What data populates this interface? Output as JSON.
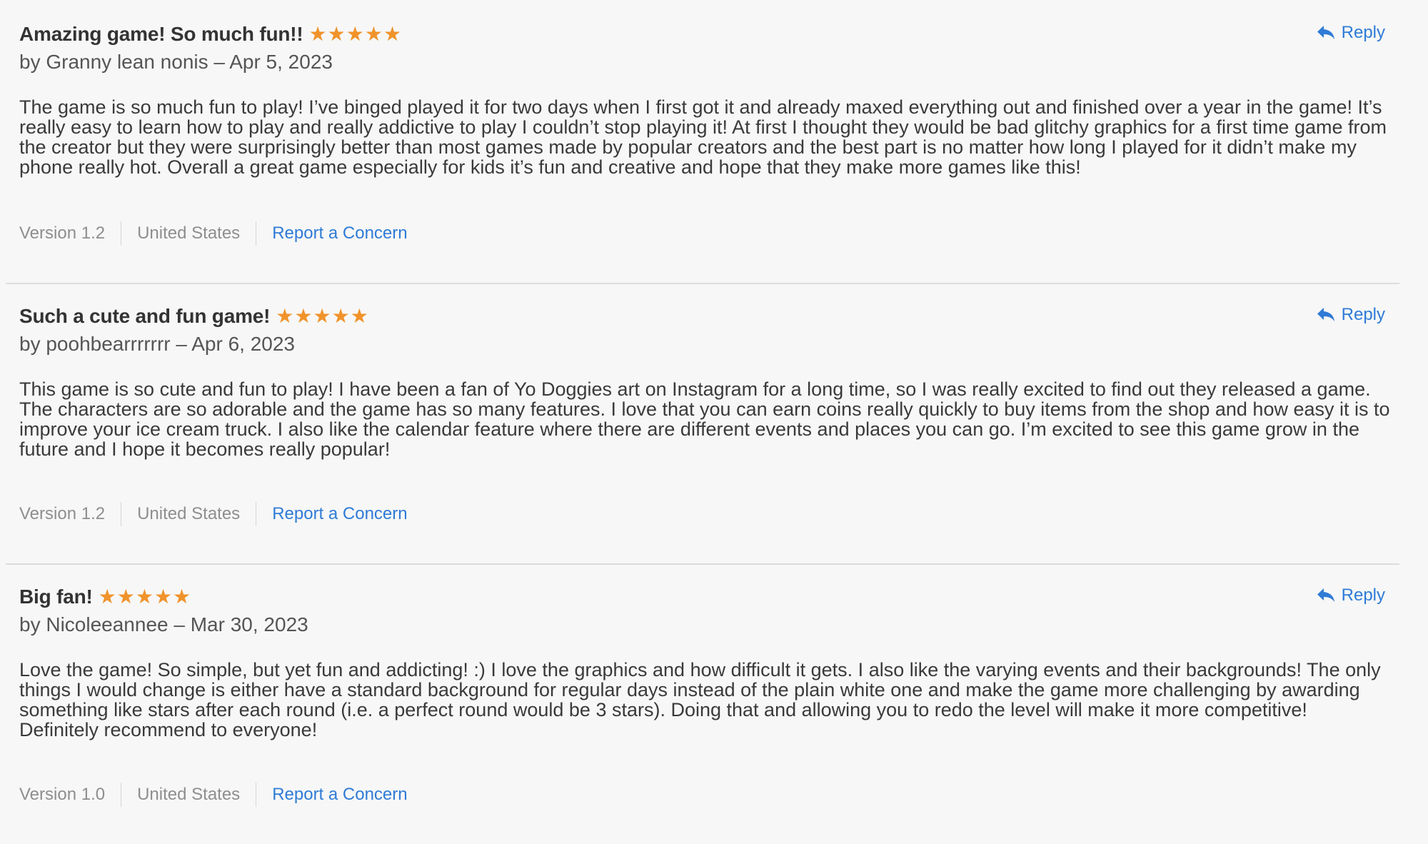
{
  "reviews": [
    {
      "title": "Amazing game! So much fun!!",
      "rating": 5,
      "byline": "by Granny lean nonis – Apr 5, 2023",
      "reply_label": "Reply",
      "body": "The game is so much fun to play! I’ve binged played it for two days when I first got it and already maxed everything out and finished over a year in the game! It’s really easy to learn how to play and really addictive to play I couldn’t stop playing it! At first I thought they would be bad glitchy graphics for a first time game from the creator but they were surprisingly better than most games made by popular creators and the best part is no matter how long I played for it didn’t make my phone really hot. Overall a great game especially for kids it’s fun and creative and hope that they make more games like this!",
      "version": "Version 1.2",
      "country": "United States",
      "report_label": "Report a Concern"
    },
    {
      "title": "Such a cute and fun game!",
      "rating": 5,
      "byline": "by poohbearrrrrrr – Apr 6, 2023",
      "reply_label": "Reply",
      "body": "This game is so cute and fun to play! I have been a fan of Yo Doggies art on Instagram for a long time, so I was really excited to find out they released a game. The characters are so adorable and the game has so many features. I love that you can earn coins really quickly to buy items from the shop and how easy it is to improve your ice cream truck. I also like the calendar feature where there are different events and places you can go. I’m excited to see this game grow in the future and I hope it becomes really popular!",
      "version": "Version 1.2",
      "country": "United States",
      "report_label": "Report a Concern"
    },
    {
      "title": "Big fan!",
      "rating": 5,
      "byline": "by Nicoleeannee – Mar 30, 2023",
      "reply_label": "Reply",
      "body": "Love the game! So simple, but yet fun and addicting! :) I love the graphics and how difficult it gets. I also like the varying events and their backgrounds! The only things I would change is either have a standard background for regular days instead of the plain white one and make the game more challenging by awarding something like stars after each round (i.e. a perfect round would be 3 stars). Doing that and allowing you to redo the level will make it more competitive! Definitely recommend to everyone!",
      "version": "Version 1.0",
      "country": "United States",
      "report_label": "Report a Concern"
    }
  ],
  "colors": {
    "background": "#f7f7f7",
    "star": "#f0932b",
    "link": "#2f7bd6",
    "meta_text": "#8e8e8e",
    "separator": "#dcdcdc"
  },
  "icons": {
    "reply": "reply-arrow-icon",
    "star": "star-icon"
  }
}
